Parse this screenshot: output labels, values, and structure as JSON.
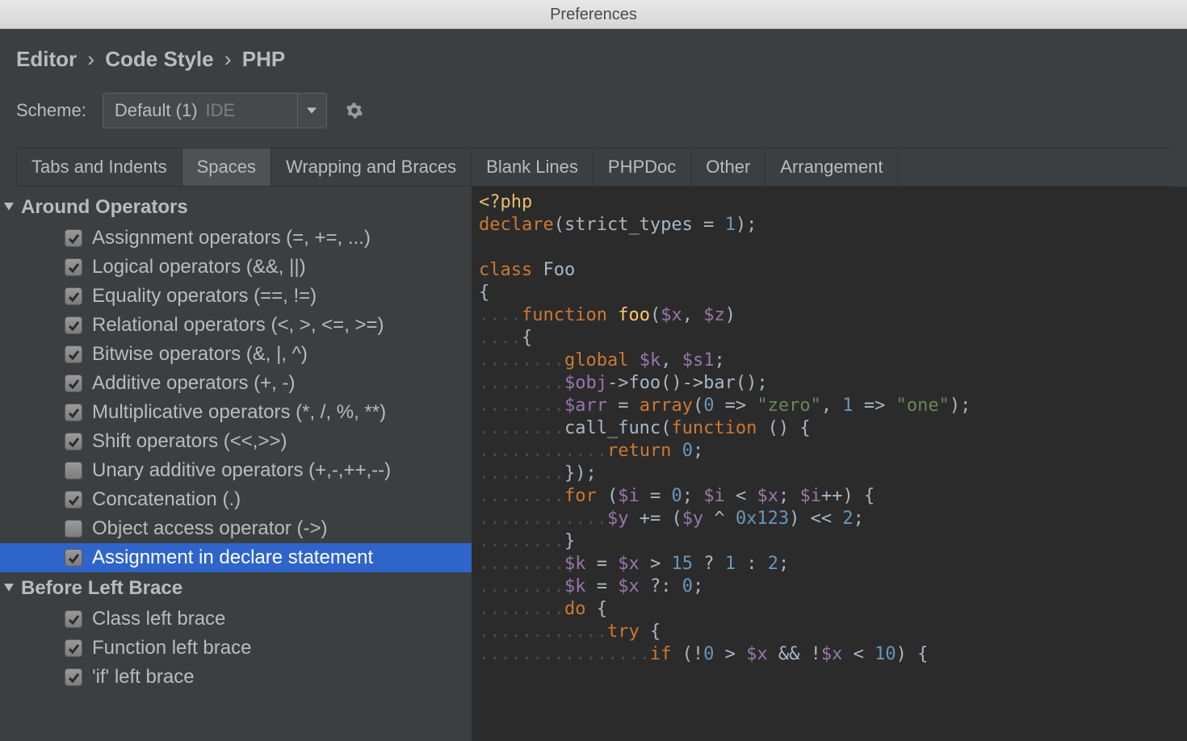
{
  "window": {
    "title": "Preferences"
  },
  "breadcrumb": {
    "a": "Editor",
    "b": "Code Style",
    "c": "PHP"
  },
  "scheme": {
    "label": "Scheme:",
    "value": "Default (1)",
    "badge": "IDE"
  },
  "tabs": [
    {
      "label": "Tabs and Indents",
      "active": false
    },
    {
      "label": "Spaces",
      "active": true
    },
    {
      "label": "Wrapping and Braces",
      "active": false
    },
    {
      "label": "Blank Lines",
      "active": false
    },
    {
      "label": "PHPDoc",
      "active": false
    },
    {
      "label": "Other",
      "active": false
    },
    {
      "label": "Arrangement",
      "active": false
    }
  ],
  "sections": [
    {
      "title": "Around Operators",
      "items": [
        {
          "label": "Assignment operators (=, +=, ...)",
          "checked": true,
          "selected": false
        },
        {
          "label": "Logical operators (&&, ||)",
          "checked": true,
          "selected": false
        },
        {
          "label": "Equality operators (==, !=)",
          "checked": true,
          "selected": false
        },
        {
          "label": "Relational operators (<, >, <=, >=)",
          "checked": true,
          "selected": false
        },
        {
          "label": "Bitwise operators (&, |, ^)",
          "checked": true,
          "selected": false
        },
        {
          "label": "Additive operators (+, -)",
          "checked": true,
          "selected": false
        },
        {
          "label": "Multiplicative operators (*, /, %, **)",
          "checked": true,
          "selected": false
        },
        {
          "label": "Shift operators (<<,>>)",
          "checked": true,
          "selected": false
        },
        {
          "label": "Unary additive operators (+,-,++,--)",
          "checked": false,
          "selected": false
        },
        {
          "label": "Concatenation (.)",
          "checked": true,
          "selected": false
        },
        {
          "label": "Object access operator (->)",
          "checked": false,
          "selected": false
        },
        {
          "label": "Assignment in declare statement",
          "checked": true,
          "selected": true
        }
      ]
    },
    {
      "title": "Before Left Brace",
      "items": [
        {
          "label": "Class left brace",
          "checked": true,
          "selected": false
        },
        {
          "label": "Function left brace",
          "checked": true,
          "selected": false
        },
        {
          "label": "'if' left brace",
          "checked": true,
          "selected": false
        }
      ]
    }
  ],
  "code": {
    "l1": {
      "open": "<?php"
    },
    "l2": {
      "kw": "declare",
      "p1": "(",
      "id": "strict_types",
      "eq": " = ",
      "num": "1",
      "p2": ");"
    },
    "l3": "",
    "l4": {
      "kw": "class",
      "sp": " ",
      "id": "Foo"
    },
    "l5": {
      "p": "{"
    },
    "l6": {
      "ws": "    ",
      "kw": "function",
      "sp": " ",
      "fn": "foo",
      "p1": "(",
      "v1": "$x",
      "c": ", ",
      "v2": "$z",
      "p2": ")"
    },
    "l7": {
      "ws": "    ",
      "p": "{"
    },
    "l8": {
      "ws": "        ",
      "kw": "global",
      "sp": " ",
      "v1": "$k",
      "c": ", ",
      "v2": "$s1",
      "p": ";"
    },
    "l9": {
      "ws": "        ",
      "v": "$obj",
      "t": "->foo()->bar();"
    },
    "l10": {
      "ws": "        ",
      "v": "$arr",
      "eq": " = ",
      "kw": "array",
      "p1": "(",
      "n1": "0",
      "a1": " => ",
      "s1": "\"zero\"",
      "c": ", ",
      "n2": "1",
      "a2": " => ",
      "s2": "\"one\"",
      "p2": ");"
    },
    "l11": {
      "ws": "        ",
      "fn": "call_func",
      "p1": "(",
      "kw": "function",
      "sp": " ",
      "args": "()",
      "sp2": " ",
      "br": "{"
    },
    "l12": {
      "ws": "            ",
      "kw": "return",
      "sp": " ",
      "n": "0",
      "p": ";"
    },
    "l13": {
      "ws": "        ",
      "p": "});"
    },
    "l14": {
      "ws": "        ",
      "kw": "for",
      "sp": " ",
      "p1": "(",
      "v1": "$i",
      "eq1": " = ",
      "n1": "0",
      "sc1": "; ",
      "v2": "$i",
      "op": " < ",
      "v3": "$x",
      "sc2": "; ",
      "v4": "$i",
      "inc": "++",
      "p2": ") {"
    },
    "l15": {
      "ws": "            ",
      "v1": "$y",
      "op1": " += ",
      "p1": "(",
      "v2": "$y",
      "op2": " ^ ",
      "hex": "0x123",
      "p2": ")",
      "op3": " << ",
      "n": "2",
      "p3": ";"
    },
    "l16": {
      "ws": "        ",
      "p": "}"
    },
    "l17": {
      "ws": "        ",
      "v1": "$k",
      "eq": " = ",
      "v2": "$x",
      "op1": " > ",
      "n1": "15",
      "q": " ? ",
      "n2": "1",
      "col": " : ",
      "n3": "2",
      "p": ";"
    },
    "l18": {
      "ws": "        ",
      "v1": "$k",
      "eq": " = ",
      "v2": "$x",
      "op": " ?: ",
      "n": "0",
      "p": ";"
    },
    "l19": {
      "ws": "        ",
      "kw": "do",
      "sp": " ",
      "p": "{"
    },
    "l20": {
      "ws": "            ",
      "kw": "try",
      "sp": " ",
      "p": "{"
    },
    "l21": {
      "ws": "                ",
      "kw": "if",
      "sp": " ",
      "p1": "(!",
      "n1": "0",
      "op1": " > ",
      "v1": "$x",
      "op2": " && !",
      "v2": "$x",
      "op3": " < ",
      "n2": "10",
      "p2": ") {"
    }
  }
}
